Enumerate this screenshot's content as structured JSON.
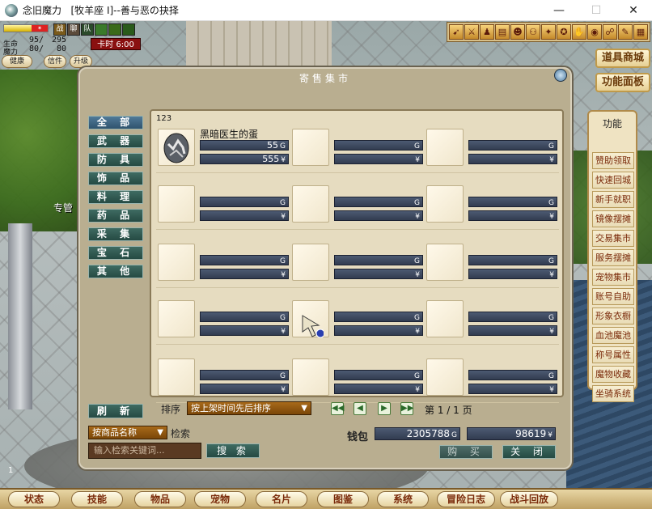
{
  "window": {
    "title": "念旧魔力   [牧羊座 Ⅰ]--善与恶の抉择",
    "minimize": "—",
    "maximize": "☐",
    "close": "✕"
  },
  "status": {
    "label_hp": "生命",
    "label_mp": "魔力",
    "hp": "95/",
    "hp_max": "295",
    "mp": "80/",
    "mp_max": "80",
    "time_label": "卡时",
    "time_value": "6:00",
    "icons": [
      "战",
      "聊",
      "队",
      "",
      ""
    ],
    "health_label": "健康",
    "mail_label": "信件",
    "levelup_label": "升级"
  },
  "toolbar": {
    "icons": [
      "bow-icon",
      "sword-icon",
      "party-icon",
      "card-icon",
      "team-icon",
      "group-icon",
      "dance-icon",
      "stamp-icon",
      "skill-icon",
      "eye-icon",
      "vs-icon",
      "tools-icon",
      "book-icon"
    ]
  },
  "side_tabs": {
    "shop": "道具商城",
    "function_panel": "功能面板"
  },
  "function_panel": {
    "title": "功能",
    "items": [
      "赞助领取",
      "快速回城",
      "新手就职",
      "镜像摆摊",
      "交易集市",
      "服务摆摊",
      "宠物集市",
      "账号自助",
      "形象衣橱",
      "血池魔池",
      "称号属性",
      "魔物收藏",
      "坐骑系统"
    ]
  },
  "background": {
    "npc_text": "专管",
    "corner_num": "1"
  },
  "market": {
    "title": "寄售集市",
    "categories": [
      "全 部",
      "武 器",
      "防 具",
      "饰 品",
      "料 理",
      "药 品",
      "采 集",
      "宝 石",
      "其 他"
    ],
    "selected_category": 0,
    "refresh_label": "刷 新",
    "count": "123",
    "item": {
      "name": "黑暗医生的蛋",
      "gold": "55",
      "gold_unit": "G",
      "yen": "555",
      "yen_unit": "¥"
    },
    "unit_g": "G",
    "unit_y": "¥",
    "sort_label": "排序",
    "sort_value": "按上架时间先后排序",
    "page_info": "第 1 / 1 页",
    "search_type": "按商品名称",
    "search_label": "检索",
    "search_placeholder": "输入检索关键词...",
    "search_button": "搜 索",
    "wallet_label": "钱包",
    "wallet_gold": "2305788",
    "wallet_yen": "98619",
    "buy_button": "购 买",
    "close_button": "关 闭"
  },
  "bottom_menu": [
    "状态",
    "技能",
    "物品",
    "宠物",
    "名片",
    "图鉴",
    "系统",
    "冒险日志",
    "战斗回放"
  ]
}
